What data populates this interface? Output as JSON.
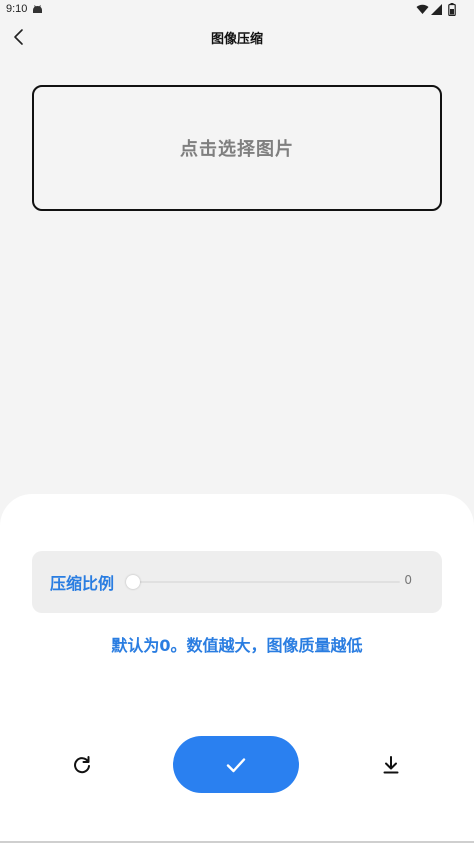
{
  "status_bar": {
    "time": "9:10",
    "app_icon": "android-icon",
    "icons": [
      "wifi-icon",
      "signal-icon",
      "battery-icon"
    ]
  },
  "header": {
    "back_icon": "chevron-left-icon",
    "title": "图像压缩"
  },
  "picker": {
    "label": "点击选择图片"
  },
  "compression": {
    "label": "压缩比例",
    "value": "0",
    "hint": "默认为0。数值越大，图像质量越低"
  },
  "actions": {
    "reset_icon": "refresh-icon",
    "confirm_icon": "check-icon",
    "download_icon": "download-icon"
  },
  "colors": {
    "accent": "#2a7de1",
    "button": "#2a80f0",
    "background": "#f4f4f4",
    "sheet": "#ffffff"
  }
}
